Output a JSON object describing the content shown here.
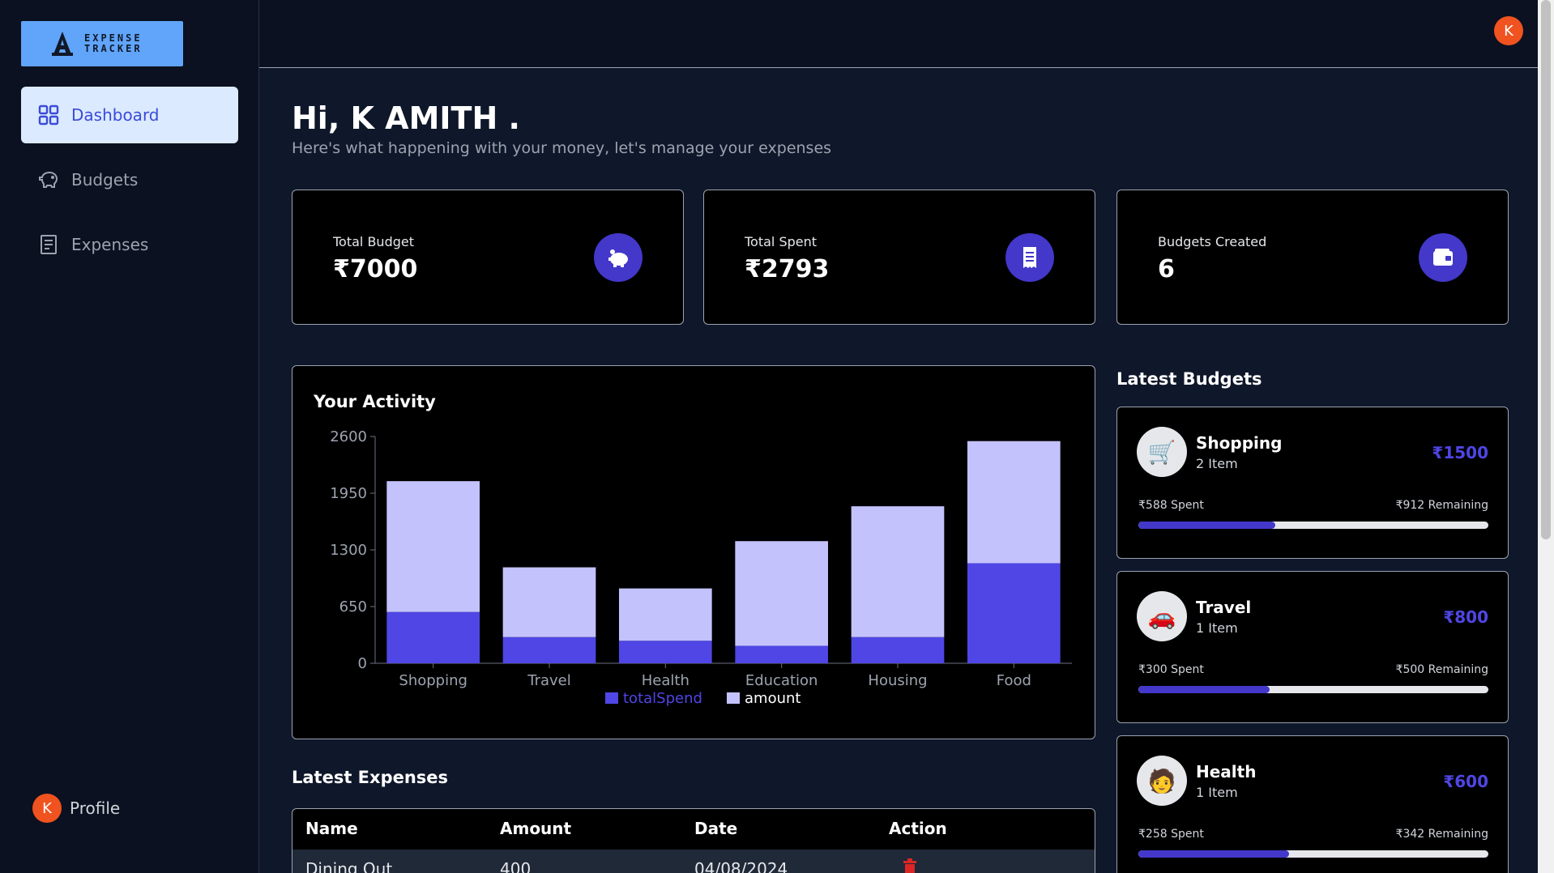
{
  "app": {
    "logo_line1": "EXPENSE",
    "logo_line2": "TRACKER"
  },
  "sidebar": {
    "items": [
      {
        "label": "Dashboard",
        "icon": "grid-icon",
        "active": true
      },
      {
        "label": "Budgets",
        "icon": "piggy-bank-icon",
        "active": false
      },
      {
        "label": "Expenses",
        "icon": "receipt-icon",
        "active": false
      }
    ],
    "profile_label": "Profile",
    "profile_initial": "K"
  },
  "header": {
    "avatar_initial": "K"
  },
  "greeting": {
    "title": "Hi, K AMITH .",
    "subtitle": "Here's what happening with your money, let's manage your expenses"
  },
  "cards": [
    {
      "label": "Total Budget",
      "value": "₹7000",
      "icon": "piggy-bank-icon"
    },
    {
      "label": "Total Spent",
      "value": "₹2793",
      "icon": "receipt-icon"
    },
    {
      "label": "Budgets Created",
      "value": "6",
      "icon": "wallet-icon"
    }
  ],
  "activity": {
    "title": "Your Activity"
  },
  "chart_data": {
    "type": "bar",
    "stacked": true,
    "categories": [
      "Shopping",
      "Travel",
      "Health",
      "Education",
      "Housing",
      "Food"
    ],
    "series": [
      {
        "name": "totalSpend",
        "color": "#4f46e5",
        "values": [
          588,
          300,
          258,
          200,
          300,
          1147
        ]
      },
      {
        "name": "amount",
        "color": "#c4c2fc",
        "values": [
          1500,
          800,
          600,
          1200,
          1500,
          1400
        ]
      }
    ],
    "yticks": [
      0,
      650,
      1300,
      1950,
      2600
    ],
    "ylim": [
      0,
      2600
    ],
    "legend": "bottom"
  },
  "latest_expenses": {
    "title": "Latest Expenses",
    "columns": [
      "Name",
      "Amount",
      "Date",
      "Action"
    ],
    "rows": [
      {
        "name": "Dining Out",
        "amount": "400",
        "date": "04/08/2024",
        "action": "trash-icon"
      }
    ]
  },
  "latest_budgets": {
    "title": "Latest Budgets",
    "items": [
      {
        "name": "Shopping",
        "items": "2 Item",
        "amount": "₹1500",
        "spent": "₹588 Spent",
        "remaining": "₹912 Remaining",
        "progress": 0.392,
        "icon": "🛒"
      },
      {
        "name": "Travel",
        "items": "1 Item",
        "amount": "₹800",
        "spent": "₹300 Spent",
        "remaining": "₹500 Remaining",
        "progress": 0.375,
        "icon": "🚗"
      },
      {
        "name": "Health",
        "items": "1 Item",
        "amount": "₹600",
        "spent": "₹258 Spent",
        "remaining": "₹342 Remaining",
        "progress": 0.43,
        "icon": "🧑"
      }
    ]
  }
}
